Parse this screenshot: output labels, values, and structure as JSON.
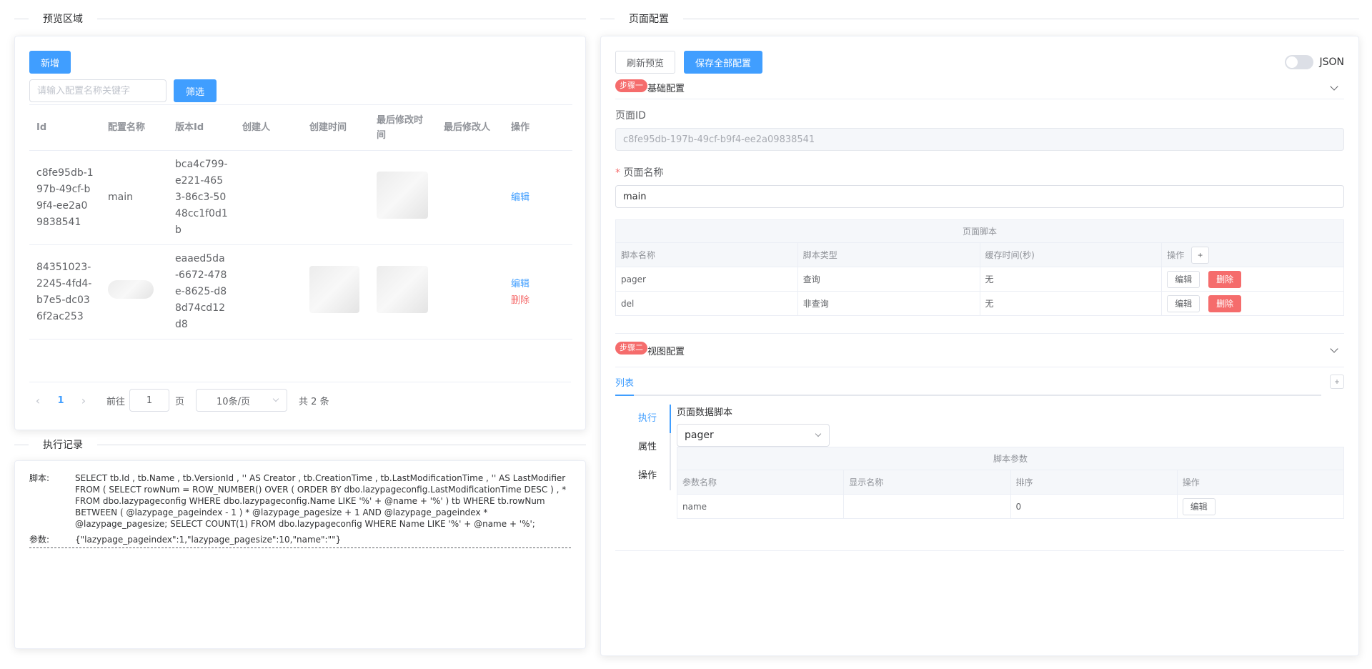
{
  "left": {
    "preview_title": "预览区域",
    "add_label": "新增",
    "search_placeholder": "请输入配置名称关键字",
    "filter_label": "筛选",
    "columns": [
      "Id",
      "配置名称",
      "版本Id",
      "创建人",
      "创建时间",
      "最后修改时间",
      "最后修改人",
      "操作"
    ],
    "rows": [
      {
        "id": "c8fe95db-197b-49cf-b9f4-ee2a09838541",
        "name": "main",
        "version": "bca4c799-e221-4653-86c3-5048cc1f0d1b",
        "actions": [
          "编辑"
        ]
      },
      {
        "id": "84351023-2245-4fd4-b7e5-dc036f2ac253",
        "name": "",
        "version": "eaaed5da-6672-478e-8625-d88d74cd12d8",
        "actions": [
          "编辑",
          "删除"
        ]
      }
    ],
    "pagination": {
      "current": "1",
      "goto_label": "前往",
      "goto_value": "1",
      "page_label": "页",
      "size": "10条/页",
      "total": "共 2 条"
    },
    "log_title": "执行记录",
    "log": {
      "script_label": "脚本:",
      "script": "SELECT tb.Id , tb.Name , tb.VersionId , '' AS Creator , tb.CreationTime , tb.LastModificationTime , '' AS LastModifier FROM ( SELECT rowNum = ROW_NUMBER() OVER ( ORDER BY dbo.lazypageconfig.LastModificationTime DESC ) , * FROM dbo.lazypageconfig WHERE dbo.lazypageconfig.Name LIKE '%' + @name + '%' ) tb WHERE tb.rowNum BETWEEN ( @lazypage_pageindex - 1 ) * @lazypage_pagesize + 1 AND @lazypage_pageindex * @lazypage_pagesize; SELECT COUNT(1) FROM dbo.lazypageconfig WHERE Name LIKE '%' + @name + '%';",
      "params_label": "参数:",
      "params": "{\"lazypage_pageindex\":1,\"lazypage_pagesize\":10,\"name\":\"\"}"
    }
  },
  "right": {
    "title": "页面配置",
    "refresh_label": "刷新预览",
    "save_label": "保存全部配置",
    "json_label": "JSON",
    "json_toggle_on": false,
    "step1": {
      "badge": "步骤一",
      "title": "基础配置"
    },
    "page_id_label": "页面ID",
    "page_id_value": "c8fe95db-197b-49cf-b9f4-ee2a09838541",
    "page_name_required": "*",
    "page_name_label": "页面名称",
    "page_name_value": "main",
    "scripts_table": {
      "caption": "页面脚本",
      "columns": [
        "脚本名称",
        "脚本类型",
        "缓存时间(秒)",
        "操作"
      ],
      "add_label": "+",
      "rows": [
        {
          "name": "pager",
          "type": "查询",
          "cache": "无"
        },
        {
          "name": "del",
          "type": "非查询",
          "cache": "无"
        }
      ],
      "edit_label": "编辑",
      "delete_label": "删除"
    },
    "step2": {
      "badge": "步骤二",
      "title": "视图配置"
    },
    "view_tab": "列表",
    "view_add": "+",
    "side_tabs": [
      "执行",
      "属性",
      "操作"
    ],
    "data_script_label": "页面数据脚本",
    "data_script_value": "pager",
    "params_table": {
      "caption": "脚本参数",
      "columns": [
        "参数名称",
        "显示名称",
        "排序",
        "操作"
      ],
      "rows": [
        {
          "name": "name",
          "display": "",
          "order": "0"
        }
      ],
      "edit_label": "编辑"
    }
  }
}
